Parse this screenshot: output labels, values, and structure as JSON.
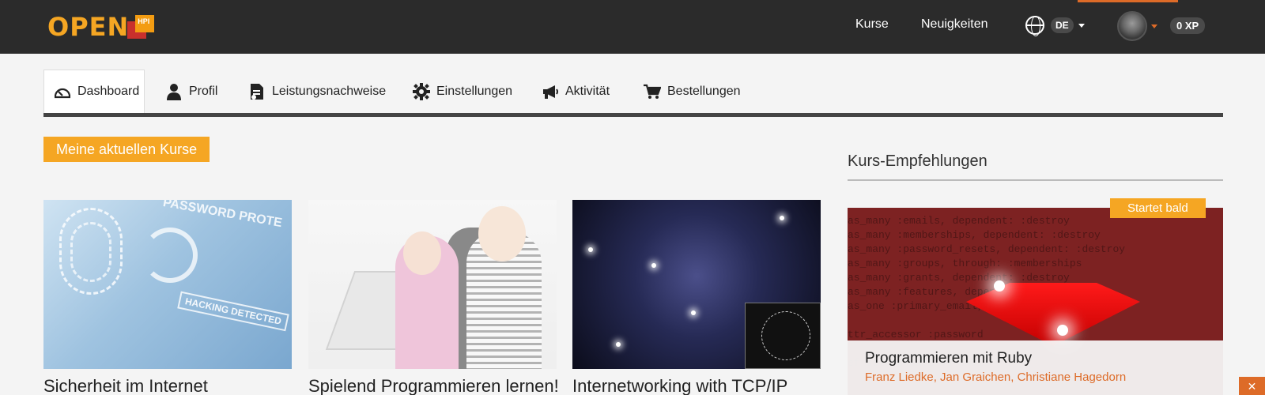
{
  "header": {
    "logo_text": "OPEN",
    "logo_badge": "HPI",
    "nav": [
      "Kurse",
      "Neuigkeiten"
    ],
    "language": "DE",
    "xp": "0 XP",
    "colors": {
      "bar": "#2b2b2b",
      "accent": "#dd6b28",
      "logo": "#f5a623"
    }
  },
  "tabs": [
    {
      "label": "Dashboard",
      "icon": "dashboard-icon",
      "active": true
    },
    {
      "label": "Profil",
      "icon": "user-icon",
      "active": false
    },
    {
      "label": "Leistungsnachweise",
      "icon": "certificate-icon",
      "active": false
    },
    {
      "label": "Einstellungen",
      "icon": "gear-icon",
      "active": false
    },
    {
      "label": "Aktivität",
      "icon": "megaphone-icon",
      "active": false
    },
    {
      "label": "Bestellungen",
      "icon": "cart-icon",
      "active": false
    }
  ],
  "main": {
    "section_title": "Meine aktuellen Kurse",
    "courses": [
      {
        "title": "Sicherheit im Internet",
        "image": "security-image"
      },
      {
        "title": "Spielend Programmieren lernen!",
        "image": "kids-coding-image"
      },
      {
        "title": "Internetworking with TCP/IP",
        "image": "network-graph-image"
      }
    ]
  },
  "recommendations": {
    "title": "Kurs-Empfehlungen",
    "card": {
      "badge": "Startet bald",
      "title": "Programmieren mit Ruby",
      "authors": "Franz Liedke, Jan Graichen, Christiane Hagedorn",
      "image": "ruby-gem-image"
    }
  },
  "corner_button": "✕"
}
